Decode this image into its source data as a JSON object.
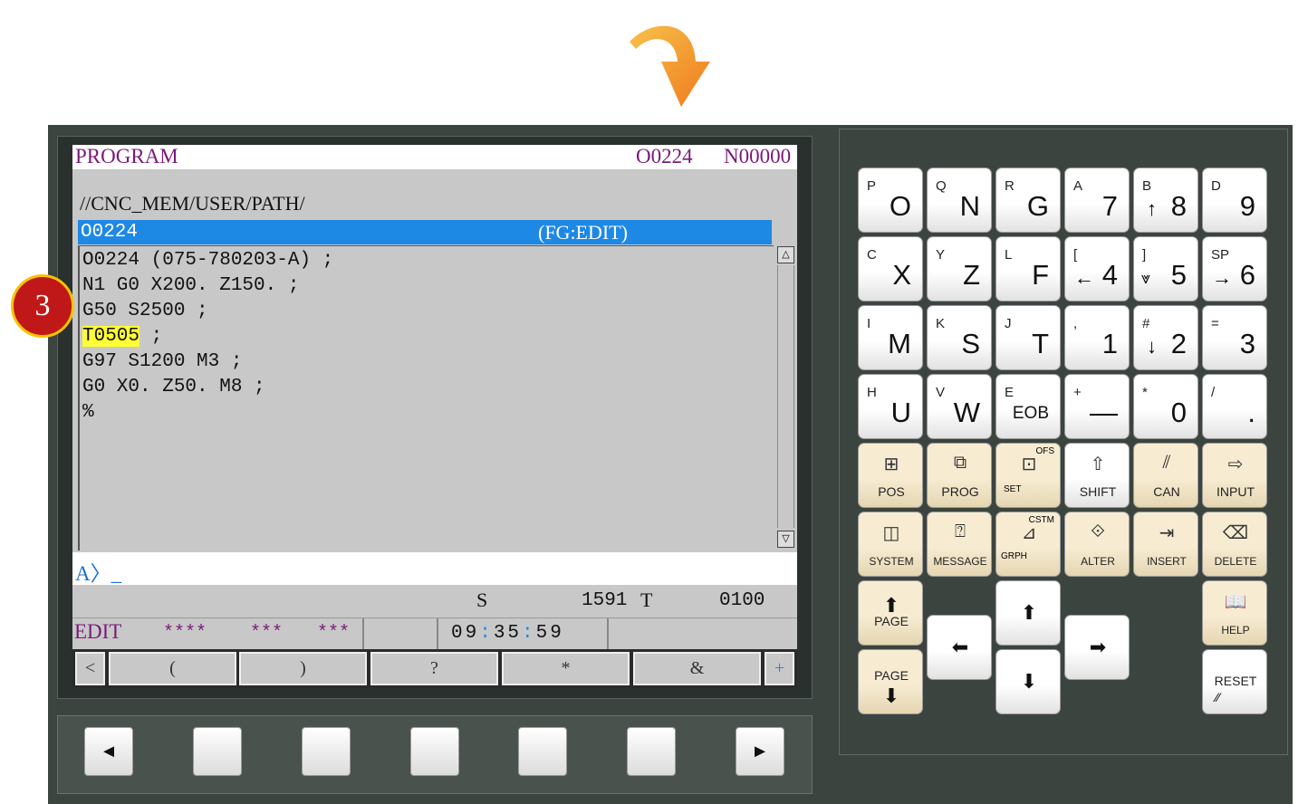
{
  "screen": {
    "header_title": "PROGRAM",
    "header_prog": "O0224",
    "header_seq": "N00000",
    "path": "//CNC_MEM/USER/PATH/",
    "selected_program": "O0224",
    "selected_mode": "(FG:EDIT)",
    "program_lines": [
      {
        "text": "O0224 (075-780203-A) ;"
      },
      {
        "text": "N1 G0 X200. Z150. ;"
      },
      {
        "text": "G50 S2500 ;"
      },
      {
        "highlight": "T0505",
        "text": " ;"
      },
      {
        "text": "G97 S1200 M3 ;"
      },
      {
        "text": "G0 X0. Z50. M8 ;"
      },
      {
        "text": "%"
      }
    ],
    "input_prompt": "A〉_",
    "s_label": "S",
    "s_value": "1591",
    "t_label": "T",
    "t_value": "0100",
    "mode": "EDIT",
    "status_1": "****",
    "status_2": "***",
    "status_3": "***",
    "clock_h": "09",
    "clock_m": "35",
    "clock_s": "59",
    "clock_sep": ":",
    "softkeys": [
      "<",
      "(",
      ")",
      "?",
      "*",
      "&",
      "+"
    ],
    "scroll_up": "△",
    "scroll_down": "▽"
  },
  "bottom_keys": [
    "◄",
    "",
    "",
    "",
    "",
    "",
    "►"
  ],
  "badge": "3",
  "keypad": {
    "char_keys": [
      {
        "sub": "P",
        "main": "O"
      },
      {
        "sub": "Q",
        "main": "N"
      },
      {
        "sub": "R",
        "main": "G"
      },
      {
        "sub": "A",
        "main": "7"
      },
      {
        "sub": "B",
        "main": "8",
        "sub_icon": "↑"
      },
      {
        "sub": "D",
        "main": "9"
      },
      {
        "sub": "C",
        "main": "X"
      },
      {
        "sub": "Y",
        "main": "Z"
      },
      {
        "sub": "L",
        "main": "F"
      },
      {
        "sub": "[",
        "main": "4",
        "sub_icon": "←"
      },
      {
        "sub": "]",
        "main": "5",
        "sub_icon": "⩔"
      },
      {
        "sub": "SP",
        "main": "6",
        "sub_icon": "→"
      },
      {
        "sub": "I",
        "main": "M"
      },
      {
        "sub": "K",
        "main": "S"
      },
      {
        "sub": "J",
        "main": "T"
      },
      {
        "sub": ",",
        "main": "1"
      },
      {
        "sub": "#",
        "main": "2",
        "sub_icon": "↓"
      },
      {
        "sub": "=",
        "main": "3"
      },
      {
        "sub": "H",
        "main": "U"
      },
      {
        "sub": "V",
        "main": "W"
      },
      {
        "sub": "E",
        "main": "EOB"
      },
      {
        "sub": "+",
        "main": "—"
      },
      {
        "sub": "*",
        "main": "0"
      },
      {
        "sub": "/",
        "main": "."
      }
    ],
    "func_keys_row1": [
      {
        "label": "POS",
        "icon": "pos-icon"
      },
      {
        "label": "PROG",
        "icon": "prog-icon"
      },
      {
        "label": "SET",
        "label2": "OFS",
        "icon": "offset-setting-icon"
      },
      {
        "label": "SHIFT",
        "icon": "shift-icon"
      },
      {
        "label": "CAN",
        "icon": "cancel-icon"
      },
      {
        "label": "INPUT",
        "icon": "input-icon"
      }
    ],
    "func_keys_row2": [
      {
        "label": "SYSTEM",
        "icon": "system-icon"
      },
      {
        "label": "MESSAGE",
        "icon": "message-icon"
      },
      {
        "label": "GRPH",
        "label2": "CSTM",
        "icon": "graph-icon"
      },
      {
        "label": "ALTER",
        "icon": "alter-icon"
      },
      {
        "label": "INSERT",
        "icon": "insert-icon"
      },
      {
        "label": "DELETE",
        "icon": "delete-icon"
      }
    ],
    "page_up": "PAGE",
    "page_down": "PAGE",
    "help": "HELP",
    "reset": "RESET"
  }
}
